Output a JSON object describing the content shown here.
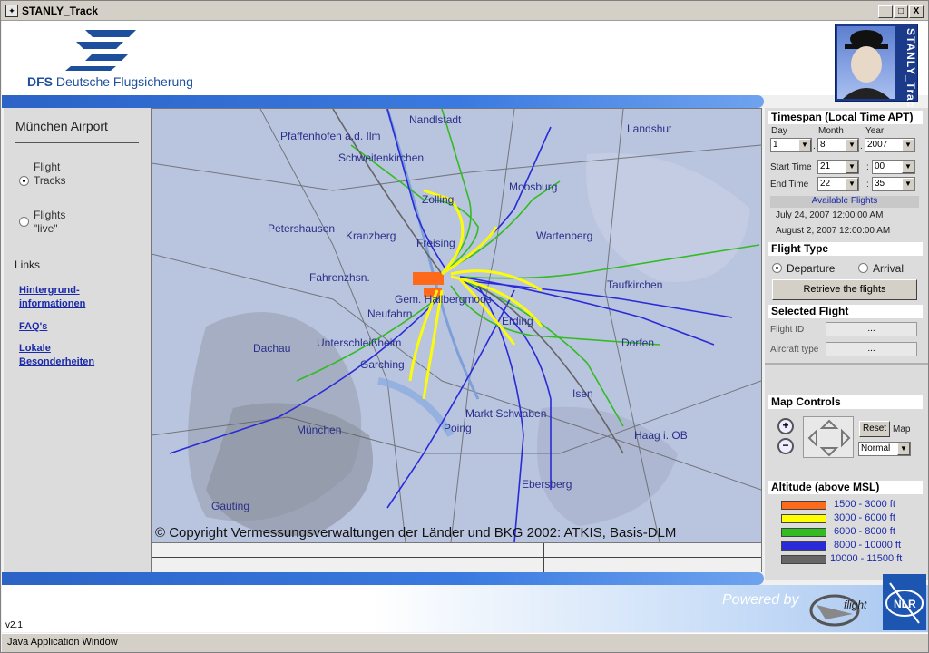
{
  "window": {
    "title": "STANLY_Track",
    "minimize": "_",
    "maximize": "□",
    "close": "X"
  },
  "header": {
    "dfs_bold": "DFS",
    "dfs_name": "Deutsche Flugsicherung",
    "badge_text": "STANLY_Track"
  },
  "left": {
    "airport_title": "München Airport",
    "modes": [
      {
        "label": "Flight Tracks",
        "selected": true
      },
      {
        "label": "Flights \"live\"",
        "selected": false
      }
    ],
    "links_title": "Links",
    "links": [
      "Hintergrund-informationen",
      "FAQ's",
      "Lokale Besonderheiten"
    ]
  },
  "map": {
    "copyright": "© Copyright Vermessungsverwaltungen der Länder und BKG 2002: ATKIS, Basis-DLM",
    "places": [
      "Nandlstadt",
      "Landshut",
      "Pfaffenhofen a.d. Ilm",
      "Schweitenkirchen",
      "Zolling",
      "Moosburg",
      "Petershausen",
      "Kranzberg",
      "Freising",
      "Wartenberg",
      "Fahrenzhsn.",
      "Gem. Hallbergmoos",
      "Taufkirchen",
      "Neufahrn",
      "Erding",
      "Dachau",
      "Unterschleißheim",
      "Garching",
      "Dorfen",
      "Isen",
      "Markt Schwaben",
      "München",
      "Poing",
      "Haag i. OB",
      "Ebersberg",
      "Gauting"
    ]
  },
  "right": {
    "timespan_title": "Timespan (Local Time APT)",
    "day_label": "Day",
    "month_label": "Month",
    "year_label": "Year",
    "day_value": "1",
    "month_value": "8",
    "year_value": "2007",
    "date_sep_1": ".",
    "date_sep_2": ".",
    "start_label": "Start Time",
    "start_hour": "21",
    "start_min": "00",
    "end_label": "End Time",
    "end_hour": "22",
    "end_min": "35",
    "time_sep": ":",
    "available_title": "Available Flights",
    "available": [
      "July 24, 2007 12:00:00 AM",
      "August 2, 2007 12:00:00 AM"
    ],
    "flight_type_title": "Flight Type",
    "departure_label": "Departure",
    "arrival_label": "Arrival",
    "retrieve_button": "Retrieve the flights",
    "selected_title": "Selected Flight",
    "flight_id_label": "Flight ID",
    "aircraft_label": "Aircraft type",
    "flight_id_value": "...",
    "aircraft_value": "...",
    "map_controls_title": "Map Controls",
    "reset_button": "Reset",
    "map_label": "Map",
    "map_mode": "Normal",
    "altitude_title": "Altitude (above MSL)",
    "altitude_legend": [
      {
        "label": "1500 -   3000 ft",
        "color": "#ff6a1a"
      },
      {
        "label": "3000 -   6000 ft",
        "color": "#ffff00"
      },
      {
        "label": "6000 -   8000 ft",
        "color": "#33bb22"
      },
      {
        "label": "8000 - 10000 ft",
        "color": "#2a2ad8"
      },
      {
        "label": "10000 - 11500 ft",
        "color": "#666666"
      }
    ]
  },
  "footer": {
    "powered_by": "Powered by",
    "nlr": "NLR",
    "version": "v2.1",
    "status": "Java Application Window"
  }
}
